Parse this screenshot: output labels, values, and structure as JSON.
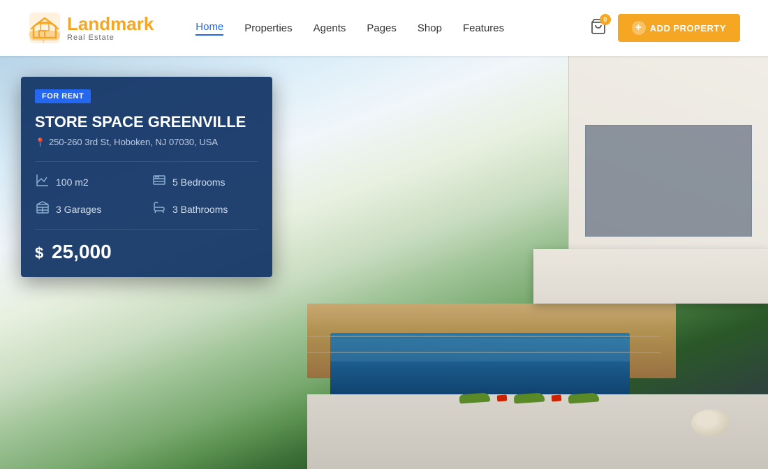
{
  "header": {
    "logo": {
      "brand_prefix": "Land",
      "brand_suffix": "mark",
      "subtitle": "Real Estate"
    },
    "nav": {
      "items": [
        {
          "label": "Home",
          "active": true
        },
        {
          "label": "Properties",
          "active": false
        },
        {
          "label": "Agents",
          "active": false
        },
        {
          "label": "Pages",
          "active": false
        },
        {
          "label": "Shop",
          "active": false
        },
        {
          "label": "Features",
          "active": false
        }
      ]
    },
    "cart": {
      "badge": "0"
    },
    "add_property_btn": "ADD PROPERTY"
  },
  "hero": {
    "card": {
      "badge": "FOR RENT",
      "title": "STORE SPACE GREENVILLE",
      "address": "250-260 3rd St, Hoboken, NJ 07030, USA",
      "features": [
        {
          "icon": "area",
          "label": "100 m2"
        },
        {
          "icon": "bed",
          "label": "5 Bedrooms"
        },
        {
          "icon": "garage",
          "label": "3 Garages"
        },
        {
          "icon": "bath",
          "label": "3 Bathrooms"
        }
      ],
      "price_symbol": "$",
      "price": "25,000"
    }
  }
}
